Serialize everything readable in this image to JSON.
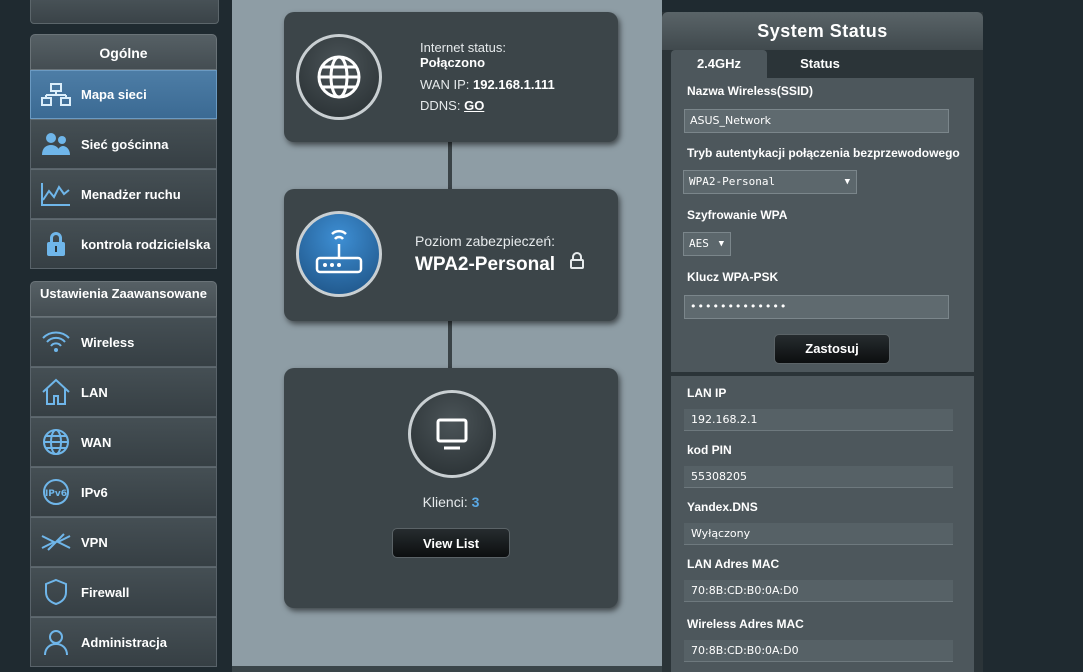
{
  "sidebar": {
    "general_title": "Ogólne",
    "general_items": [
      {
        "label": "Mapa sieci",
        "icon": "network-map-icon",
        "active": true
      },
      {
        "label": "Sieć gościnna",
        "icon": "guest-network-icon"
      },
      {
        "label": "Menadżer ruchu",
        "icon": "traffic-manager-icon"
      },
      {
        "label": "kontrola rodzicielska",
        "icon": "parental-control-icon"
      }
    ],
    "advanced_title": "Ustawienia Zaawansowane",
    "advanced_items": [
      {
        "label": "Wireless",
        "icon": "wireless-icon"
      },
      {
        "label": "LAN",
        "icon": "home-icon"
      },
      {
        "label": "WAN",
        "icon": "globe-icon"
      },
      {
        "label": "IPv6",
        "icon": "ipv6-icon"
      },
      {
        "label": "VPN",
        "icon": "vpn-icon"
      },
      {
        "label": "Firewall",
        "icon": "shield-icon"
      },
      {
        "label": "Administracja",
        "icon": "admin-user-icon"
      }
    ]
  },
  "map": {
    "internet": {
      "status_label": "Internet status:",
      "status_value": "Połączono",
      "wan_ip_label": "WAN IP:",
      "wan_ip_value": "192.168.1.111",
      "ddns_label": "DDNS:",
      "ddns_link": "GO"
    },
    "router": {
      "security_label": "Poziom zabezpieczeń:",
      "security_value": "WPA2-Personal"
    },
    "clients": {
      "label": "Klienci:",
      "count": "3",
      "view_list_button": "View List"
    }
  },
  "status_panel": {
    "title": "System Status",
    "tabs": [
      "2.4GHz",
      "Status"
    ],
    "ssid_label": "Nazwa Wireless(SSID)",
    "ssid_value": "ASUS_Network",
    "auth_label": "Tryb autentykacji połączenia bezprzewodowego",
    "auth_value": "WPA2-Personal",
    "encryption_label": "Szyfrowanie WPA",
    "encryption_value": "AES",
    "psk_label": "Klucz WPA-PSK",
    "psk_value": "•••••••••••••",
    "apply_button": "Zastosuj",
    "lan_ip_label": "LAN IP",
    "lan_ip_value": "192.168.2.1",
    "pin_label": "kod PIN",
    "pin_value": "55308205",
    "yandex_label": "Yandex.DNS",
    "yandex_value": "Wyłączony",
    "lan_mac_label": "LAN Adres MAC",
    "lan_mac_value": "70:8B:CD:B0:0A:D0",
    "wireless_mac_label": "Wireless Adres MAC",
    "wireless_mac_value": "70:8B:CD:B0:0A:D0"
  },
  "colors": {
    "accent_blue": "#4d7da6",
    "clients_count": "#5aa9e6",
    "map_bg": "#8e9da5"
  }
}
